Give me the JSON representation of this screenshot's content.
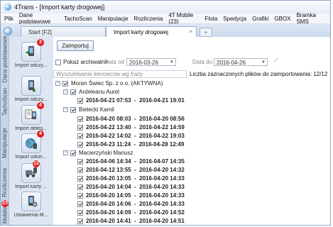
{
  "window": {
    "title": "4Trans - [Import karty drogowej]"
  },
  "menu": [
    "Plik",
    "Dane podstawowe",
    "TachoScan",
    "Manipulacje",
    "Rozliczenia",
    "4T Mobile (23)",
    "Flota",
    "Spedycja",
    "Grafiki",
    "GBOX",
    "Bramka SMS"
  ],
  "tabs": [
    {
      "label": "Start [F2]"
    },
    {
      "label": "Import karty drogowej"
    }
  ],
  "sidebar": {
    "vtabs": [
      "Dane podstawowe",
      "TachoScan",
      "Manipulacje",
      "Rozliczenia",
      "Mobile"
    ],
    "items": [
      {
        "label": "Import odczy...",
        "badge": "3"
      },
      {
        "label": "Import odczy...",
        "badge": ""
      },
      {
        "label": "Import deleg...",
        "badge": "4"
      },
      {
        "label": "Import odcin...",
        "badge": "4"
      },
      {
        "label": "Import karty ...",
        "badge": "12"
      },
      {
        "label": "Ustawienia M...",
        "badge": ""
      }
    ],
    "mobile_badge": "23"
  },
  "toolbar": {
    "import_label": "Zaimportuj"
  },
  "filters": {
    "show_archived_label": "Pokaż archiwalne",
    "date_from_label": "Data od",
    "date_from": "2016-03-26",
    "date_to_label": "Data do",
    "date_to": "2016-04-26"
  },
  "search": {
    "placeholder": "Wyszukiwanie kierowców wg frazy"
  },
  "count_text": "Liczba zaznaczonych plików do zaimportowania: 12/12",
  "tree": {
    "company": "Moran Świec Sp. z o.o. (AKTYWNA)",
    "drivers": [
      {
        "name": "Ardeleanu Aurel",
        "entries": [
          "2016-04-21 07:53  -  2016-04-21 19:01"
        ]
      },
      {
        "name": "Bielecki Kamil",
        "entries": [
          "2016-04-20 08:03  -  2016-04-20 08:56",
          "2016-04-22 13:40  -  2016-04-22 14:59",
          "2016-04-22 14:02  -  2016-04-22 19:03",
          "2016-04-23 11:24  -  2016-04-28 12:49"
        ]
      },
      {
        "name": "Macierzyński Mariusz",
        "entries": [
          "2016-04-06 14:34  -  2016-04-07 14:35",
          "2016-04-12 13:55  -  2016-04-20 14:32",
          "2016-04-20 13:05  -  2016-04-20 14:33",
          "2016-04-20 14:04  -  2016-04-20 14:33",
          "2016-04-20 14:05  -  2016-04-20 14:33",
          "2016-04-20 14:06  -  2016-04-20 14:33",
          "2016-04-20 14:09  -  2016-04-20 14:52",
          "2016-04-20 14:41  -  2016-04-20 14:51"
        ]
      }
    ]
  }
}
